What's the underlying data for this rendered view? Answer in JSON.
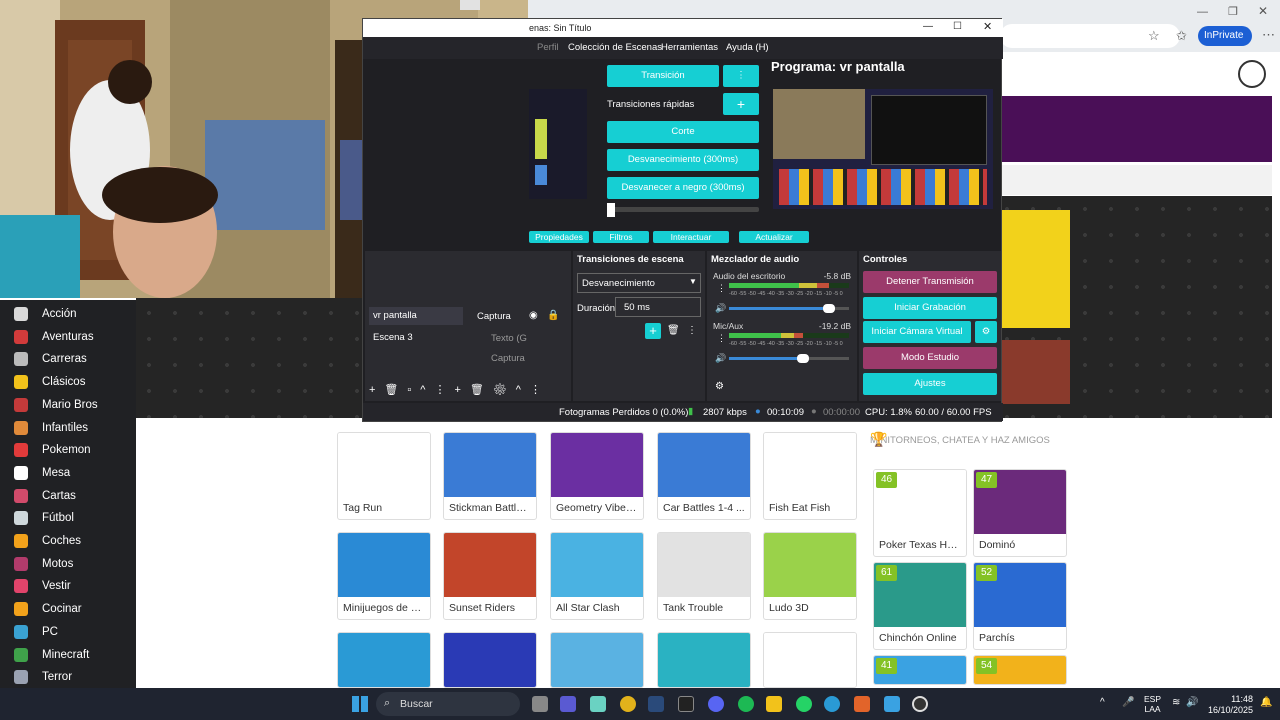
{
  "browser": {
    "inprivate_label": "InPrivate",
    "section_title": "MINITORNEOS, CHATEA Y HAZ AMIGOS"
  },
  "sidebar": {
    "items": [
      {
        "label": "Acción",
        "icon": "sword-icon",
        "color": "#d9d9d9"
      },
      {
        "label": "Aventuras",
        "icon": "flag-icon",
        "color": "#d23b3b"
      },
      {
        "label": "Carreras",
        "icon": "checkered-flag-icon",
        "color": "#bbbbbb"
      },
      {
        "label": "Clásicos",
        "icon": "pacman-icon",
        "color": "#f2c21b"
      },
      {
        "label": "Mario Bros",
        "icon": "mario-icon",
        "color": "#c43a3a"
      },
      {
        "label": "Infantiles",
        "icon": "kid-icon",
        "color": "#e08a3a"
      },
      {
        "label": "Pokemon",
        "icon": "pokeball-icon",
        "color": "#e23b3b"
      },
      {
        "label": "Mesa",
        "icon": "spade-icon",
        "color": "#ffffff"
      },
      {
        "label": "Cartas",
        "icon": "cards-icon",
        "color": "#d24b6b"
      },
      {
        "label": "Fútbol",
        "icon": "ball-icon",
        "color": "#cfd8dc"
      },
      {
        "label": "Coches",
        "icon": "car-icon",
        "color": "#f2a21b"
      },
      {
        "label": "Motos",
        "icon": "motorbike-icon",
        "color": "#b23b6b"
      },
      {
        "label": "Vestir",
        "icon": "dress-icon",
        "color": "#e2446b"
      },
      {
        "label": "Cocinar",
        "icon": "cooking-icon",
        "color": "#f2a21b"
      },
      {
        "label": "PC",
        "icon": "monitor-icon",
        "color": "#3aa2d2"
      },
      {
        "label": "Minecraft",
        "icon": "creeper-icon",
        "color": "#3fa24a"
      },
      {
        "label": "Terror",
        "icon": "skull-icon",
        "color": "#9aa2b2"
      }
    ]
  },
  "games": [
    {
      "title": "Tag Run",
      "color": "#ffffff"
    },
    {
      "title": "Stickman Battle ...",
      "color": "#3a7bd5"
    },
    {
      "title": "Geometry Vibes...",
      "color": "#6b2fa2"
    },
    {
      "title": "Car Battles 1-4 ...",
      "color": "#3a7bd5"
    },
    {
      "title": "Fish Eat Fish",
      "color": "#ffffff"
    },
    {
      "title": "Minijuegos de 2,...",
      "color": "#2a8ad5"
    },
    {
      "title": "Sunset Riders",
      "color": "#c2452a"
    },
    {
      "title": "All Star Clash",
      "color": "#4ab2e2"
    },
    {
      "title": "Tank Trouble",
      "color": "#e2e2e2"
    },
    {
      "title": "Ludo 3D",
      "color": "#9ad24a"
    },
    {
      "title": "",
      "color": "#2a9ad5"
    },
    {
      "title": "",
      "color": "#2a3ab5"
    },
    {
      "title": "",
      "color": "#5ab2e2"
    },
    {
      "title": "",
      "color": "#2ab2c2"
    },
    {
      "title": "",
      "color": "#ffffff"
    }
  ],
  "social_games": [
    {
      "title": "Poker Texas Hol...",
      "count": "46",
      "color": "#ffffff"
    },
    {
      "title": "Dominó",
      "count": "47",
      "color": "#6b2a7b"
    },
    {
      "title": "Chinchón Online",
      "count": "61",
      "color": "#2a9a8a"
    },
    {
      "title": "Parchís",
      "count": "52",
      "color": "#2a6ad2"
    },
    {
      "title": "",
      "count": "41",
      "color": "#3aa2e2"
    },
    {
      "title": "",
      "count": "54",
      "color": "#f2b21b"
    }
  ],
  "obs": {
    "window_title": "enas: Sin Título",
    "menu": [
      "Perfil",
      "Colección de Escenas",
      "Herramientas",
      "Ayuda (H)"
    ],
    "program_label": "Programa: vr pantalla",
    "transition_btn": "Transición",
    "quick_transitions": "Transiciones rápidas",
    "quick_items": [
      "Corte",
      "Desvanecimiento (300ms)",
      "Desvanecer a negro (300ms)"
    ],
    "toolbar": [
      "Propiedades",
      "Filtros",
      "Interactuar",
      "Actualizar"
    ],
    "scenes": [
      "vr pantalla",
      "Escena 3"
    ],
    "sources": [
      "Captura",
      "Texto (G",
      "Captura"
    ],
    "transitions_panel": {
      "title": "Transiciones de escena",
      "selected": "Desvanecimiento",
      "duration_label": "Duración",
      "duration_value": "50 ms"
    },
    "mixer": {
      "title": "Mezclador de audio",
      "channels": [
        {
          "name": "Audio del escritorio",
          "db": "-5.8 dB",
          "level": 0.83
        },
        {
          "name": "Mic/Aux",
          "db": "-19.2 dB",
          "level": 0.62
        }
      ],
      "scale": "-60 -55 -50 -45 -40 -35 -30 -25 -20 -15 -10 -5 0"
    },
    "controls": {
      "title": "Controles",
      "stop_stream": "Detener Transmisión",
      "start_recording": "Iniciar Grabación",
      "virtual_cam": "Iniciar Cámara Virtual",
      "studio_mode": "Modo Estudio",
      "settings": "Ajustes"
    },
    "status": {
      "dropped": "Fotogramas Perdidos 0 (0.0%)",
      "bitrate": "2807 kbps",
      "live_time": "00:10:09",
      "rec_time": "00:00:00",
      "cpu": "CPU: 1.8%",
      "fps": "60.00 / 60.00 FPS"
    }
  },
  "taskbar": {
    "search_placeholder": "Buscar",
    "lang": "ESP",
    "region": "LAA",
    "time": "11:48",
    "date": "16/10/2025"
  }
}
